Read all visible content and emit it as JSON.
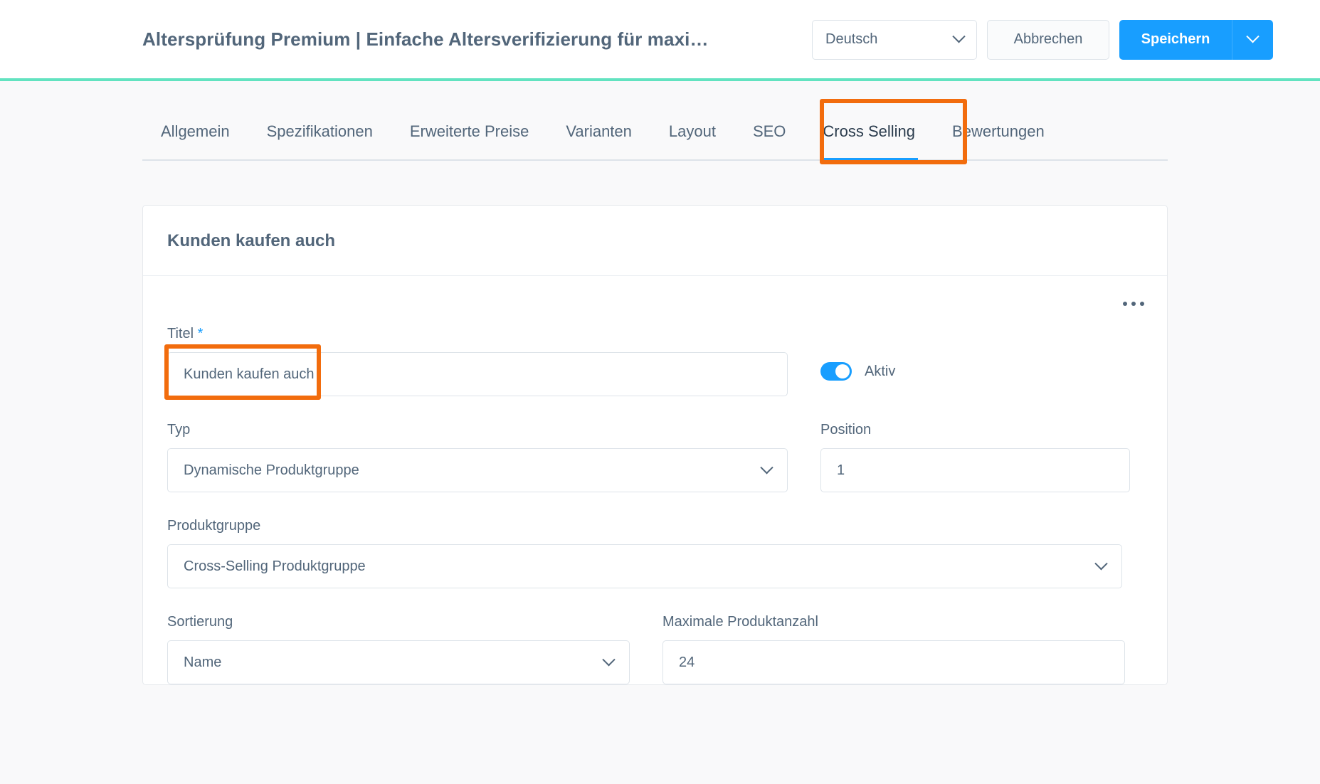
{
  "topbar": {
    "title": "Altersprüfung Premium | Einfache Altersverifizierung für maxim…",
    "language": "Deutsch",
    "cancel_label": "Abbrechen",
    "save_label": "Speichern",
    "accent_color": "#62e3c0",
    "primary_color": "#189eff"
  },
  "tabs": [
    {
      "label": "Allgemein",
      "active": false
    },
    {
      "label": "Spezifikationen",
      "active": false
    },
    {
      "label": "Erweiterte Preise",
      "active": false
    },
    {
      "label": "Varianten",
      "active": false
    },
    {
      "label": "Layout",
      "active": false
    },
    {
      "label": "SEO",
      "active": false
    },
    {
      "label": "Cross Selling",
      "active": true
    },
    {
      "label": "Bewertungen",
      "active": false
    }
  ],
  "highlight_color": "#f26c0d",
  "card": {
    "header": "Kunden kaufen auch",
    "fields": {
      "title": {
        "label": "Titel",
        "required_marker": "*",
        "value": "Kunden kaufen auch"
      },
      "active_toggle": {
        "label": "Aktiv",
        "state": "on"
      },
      "type": {
        "label": "Typ",
        "value": "Dynamische Produktgruppe"
      },
      "position": {
        "label": "Position",
        "value": "1"
      },
      "product_group": {
        "label": "Produktgruppe",
        "value": "Cross-Selling Produktgruppe"
      },
      "sorting": {
        "label": "Sortierung",
        "value": "Name"
      },
      "max_products": {
        "label": "Maximale Produktanzahl",
        "value": "24"
      }
    }
  }
}
